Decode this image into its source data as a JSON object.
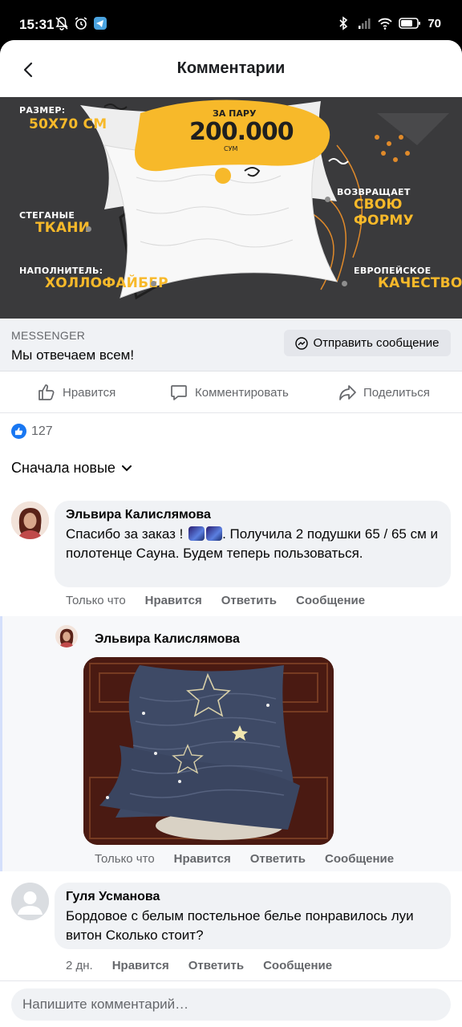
{
  "status_bar": {
    "time": "15:31",
    "battery": "70",
    "left_icons": [
      "notifications-off-icon",
      "alarm-icon",
      "telegram-icon"
    ],
    "right_icons": [
      "bluetooth-icon",
      "signal-icon",
      "wifi-icon",
      "battery-icon"
    ]
  },
  "header": {
    "title": "Комментарии",
    "back_icon": "chevron-left-icon"
  },
  "ad": {
    "size_label": "РАЗМЕР:",
    "size_value": "50Х70 СМ",
    "price_label": "ЗА ПАРУ",
    "price_value": "200.000",
    "price_currency": "СУМ",
    "feature1_small": "СТЕГАНЫЕ",
    "feature1_big": "ТКАНИ",
    "feature2_small": "НАПОЛНИТЕЛЬ:",
    "feature2_big": "ХОЛЛОФАЙБЕР",
    "feature3_small": "ВОЗВРАЩАЕТ",
    "feature3_big": "СВОЮ ФОРМУ",
    "feature4_small": "ЕВРОПЕЙСКОЕ",
    "feature4_big": "КАЧЕСТВО",
    "accent_color": "#f7b92a"
  },
  "messenger": {
    "label": "MESSENGER",
    "headline": "Мы отвечаем всем!",
    "button_label": "Отправить сообщение"
  },
  "actions": {
    "like": "Нравится",
    "comment": "Комментировать",
    "share": "Поделиться"
  },
  "reactions": {
    "count": "127"
  },
  "sort": {
    "label": "Сначала новые"
  },
  "comments": [
    {
      "author": "Эльвира Калислямова",
      "text_before": "Спасибо за заказ ! ",
      "text_after": ". Получила 2 подушки 65 / 65 см и полотенце Сауна. Будем теперь пользоваться.",
      "time": "Только что",
      "like": "Нравится",
      "reply": "Ответить",
      "message": "Сообщение"
    },
    {
      "author": "Эльвира Калислямова",
      "time": "Только что",
      "like": "Нравится",
      "reply": "Ответить",
      "message": "Сообщение"
    },
    {
      "author": "Гуля Усманова",
      "text": "Бордовое с белым постельное белье понравилось луи витон Сколько стоит?",
      "time": "2 дн.",
      "like": "Нравится",
      "reply": "Ответить",
      "message": "Сообщение"
    }
  ],
  "composer": {
    "placeholder": "Напишите комментарий…"
  }
}
